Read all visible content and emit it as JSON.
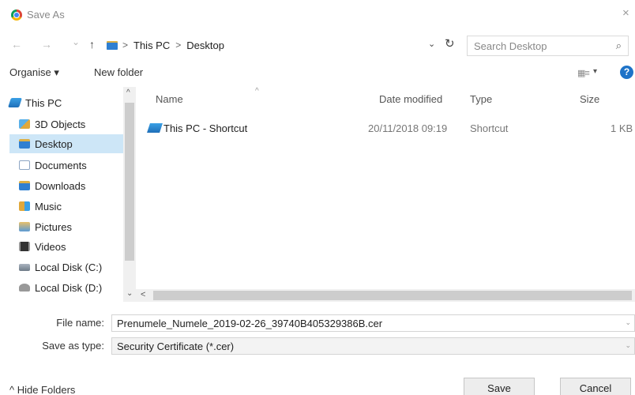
{
  "window": {
    "title": "Save As",
    "close_glyph": "×"
  },
  "navigation": {
    "back_glyph": "←",
    "forward_glyph": "→",
    "recent_glyph": "⌄",
    "up_glyph": "↑",
    "breadcrumb": [
      "This PC",
      "Desktop"
    ],
    "breadcrumb_sep": ">",
    "dropdown_glyph": "⌄",
    "refresh_glyph": "↻",
    "search_placeholder": "Search Desktop",
    "search_icon": "search-icon"
  },
  "toolbar": {
    "organise_label": "Organise ▾",
    "new_folder_label": "New folder",
    "view_glyph": "▦≡",
    "view_caret": "▾",
    "help_glyph": "?"
  },
  "sidebar": {
    "items": [
      {
        "label": "This PC",
        "icon": "computer-icon",
        "selected": false
      },
      {
        "label": "3D Objects",
        "icon": "3d-objects-icon",
        "selected": false
      },
      {
        "label": "Desktop",
        "icon": "desktop-icon",
        "selected": true
      },
      {
        "label": "Documents",
        "icon": "documents-icon",
        "selected": false
      },
      {
        "label": "Downloads",
        "icon": "downloads-icon",
        "selected": false
      },
      {
        "label": "Music",
        "icon": "music-icon",
        "selected": false
      },
      {
        "label": "Pictures",
        "icon": "pictures-icon",
        "selected": false
      },
      {
        "label": "Videos",
        "icon": "videos-icon",
        "selected": false
      },
      {
        "label": "Local Disk (C:)",
        "icon": "disk-icon",
        "selected": false
      },
      {
        "label": "Local Disk (D:)",
        "icon": "disk-icon",
        "selected": false
      }
    ],
    "scroll_up_glyph": "^",
    "scroll_down_glyph": "⌄"
  },
  "file_list": {
    "columns": [
      "Name",
      "Date modified",
      "Type",
      "Size"
    ],
    "sort_glyph": "^",
    "rows": [
      {
        "name": "This PC - Shortcut",
        "date": "20/11/2018 09:19",
        "type": "Shortcut",
        "size": "1 KB"
      }
    ],
    "hscroll_left_glyph": "<"
  },
  "form": {
    "filename_label": "File name:",
    "filename_value": "Prenumele_Numele_2019-02-26_39740B405329386B.cer",
    "savetype_label": "Save as type:",
    "savetype_value": "Security Certificate (*.cer)",
    "caret_glyph": "⌄"
  },
  "footer": {
    "hide_folders_label": "^ Hide Folders",
    "save_label": "Save",
    "cancel_label": "Cancel"
  },
  "colors": {
    "selection": "#cde6f7",
    "help": "#1e73c8",
    "folder_blue": "#2f7fd1"
  }
}
